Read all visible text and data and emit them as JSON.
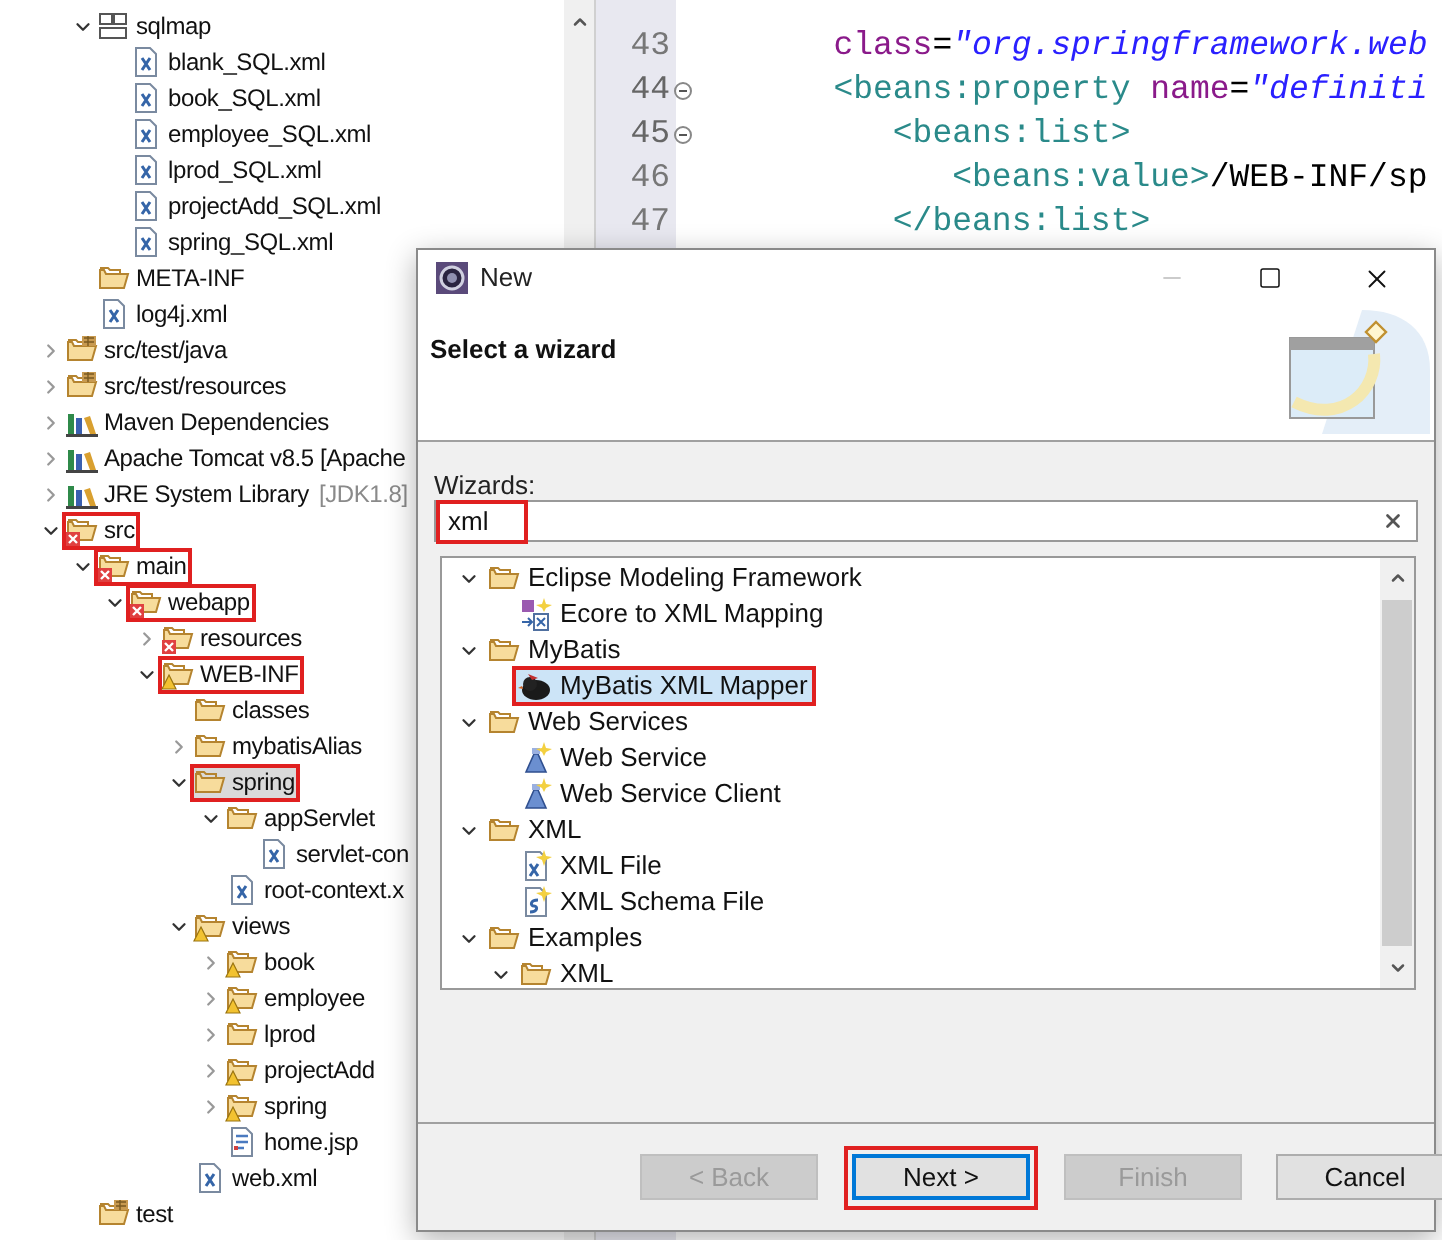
{
  "project_tree": {
    "continued_items": [
      {
        "label": "sqlmap",
        "kind": "package",
        "expanded": true,
        "selected": false,
        "annotated": false,
        "children": [
          {
            "label": "blank_SQL.xml",
            "kind": "xml-file",
            "selected": false,
            "annotated": false
          },
          {
            "label": "book_SQL.xml",
            "kind": "xml-file",
            "selected": false,
            "annotated": false
          },
          {
            "label": "employee_SQL.xml",
            "kind": "xml-file",
            "selected": false,
            "annotated": false
          },
          {
            "label": "lprod_SQL.xml",
            "kind": "xml-file",
            "selected": false,
            "annotated": false
          },
          {
            "label": "projectAdd_SQL.xml",
            "kind": "xml-file",
            "selected": false,
            "annotated": false
          },
          {
            "label": "spring_SQL.xml",
            "kind": "xml-file",
            "selected": false,
            "annotated": false
          }
        ]
      },
      {
        "label": "META-INF",
        "kind": "folder",
        "selected": false,
        "annotated": false
      },
      {
        "label": "log4j.xml",
        "kind": "xml-file",
        "selected": false,
        "annotated": false
      }
    ],
    "items": [
      {
        "label": "src/test/java",
        "kind": "source-folder",
        "expanded": false,
        "selected": false,
        "annotated": false
      },
      {
        "label": "src/test/resources",
        "kind": "source-folder",
        "expanded": false,
        "selected": false,
        "annotated": false
      },
      {
        "label": "Maven Dependencies",
        "kind": "library",
        "expanded": false,
        "selected": false,
        "annotated": false
      },
      {
        "label": "Apache Tomcat v8.5 [Apache",
        "kind": "library",
        "expanded": false,
        "selected": false,
        "annotated": false
      },
      {
        "label": "JRE System Library",
        "suffix": "[JDK1.8]",
        "kind": "library",
        "expanded": false,
        "selected": false,
        "annotated": false
      },
      {
        "label": "src",
        "kind": "error-folder",
        "expanded": true,
        "selected": false,
        "annotated": true,
        "children": [
          {
            "label": "main",
            "kind": "error-folder",
            "expanded": true,
            "selected": false,
            "annotated": true,
            "children": [
              {
                "label": "webapp",
                "kind": "error-folder",
                "expanded": true,
                "selected": false,
                "annotated": true,
                "children": [
                  {
                    "label": "resources",
                    "kind": "error-folder",
                    "expanded": false,
                    "selected": false,
                    "annotated": false
                  },
                  {
                    "label": "WEB-INF",
                    "kind": "warning-folder",
                    "expanded": true,
                    "selected": false,
                    "annotated": true,
                    "children": [
                      {
                        "label": "classes",
                        "kind": "folder",
                        "selected": false,
                        "annotated": false
                      },
                      {
                        "label": "mybatisAlias",
                        "kind": "folder",
                        "expanded": false,
                        "selected": false,
                        "annotated": false
                      },
                      {
                        "label": "spring",
                        "kind": "folder",
                        "expanded": true,
                        "selected": true,
                        "annotated": true,
                        "children": [
                          {
                            "label": "appServlet",
                            "kind": "folder",
                            "expanded": true,
                            "selected": false,
                            "annotated": false,
                            "children": [
                              {
                                "label": "servlet-con",
                                "kind": "xml-file",
                                "selected": false,
                                "annotated": false
                              }
                            ]
                          },
                          {
                            "label": "root-context.x",
                            "kind": "xml-file",
                            "selected": false,
                            "annotated": false
                          }
                        ]
                      },
                      {
                        "label": "views",
                        "kind": "warning-folder",
                        "expanded": true,
                        "selected": false,
                        "annotated": false,
                        "children": [
                          {
                            "label": "book",
                            "kind": "warning-folder",
                            "expanded": false,
                            "selected": false,
                            "annotated": false
                          },
                          {
                            "label": "employee",
                            "kind": "warning-folder",
                            "expanded": false,
                            "selected": false,
                            "annotated": false
                          },
                          {
                            "label": "lprod",
                            "kind": "folder",
                            "expanded": false,
                            "selected": false,
                            "annotated": false
                          },
                          {
                            "label": "projectAdd",
                            "kind": "warning-folder",
                            "expanded": false,
                            "selected": false,
                            "annotated": false
                          },
                          {
                            "label": "spring",
                            "kind": "warning-folder",
                            "expanded": false,
                            "selected": false,
                            "annotated": false
                          },
                          {
                            "label": "home.jsp",
                            "kind": "jsp-file",
                            "selected": false,
                            "annotated": false
                          }
                        ]
                      },
                      {
                        "label": "web.xml",
                        "kind": "xml-file",
                        "selected": false,
                        "annotated": false
                      }
                    ]
                  }
                ]
              }
            ]
          },
          {
            "label": "test",
            "kind": "source-folder",
            "selected": false,
            "annotated": false
          }
        ]
      }
    ]
  },
  "editor": {
    "lines": [
      {
        "number": "43",
        "folded": false,
        "tokens": [
          {
            "text": "   class",
            "kind": "attr"
          },
          {
            "text": "=",
            "kind": "plain"
          },
          {
            "text": "\"org.springframework.web",
            "kind": "string"
          }
        ]
      },
      {
        "number": "44",
        "folded": true,
        "tokens": [
          {
            "text": "   <beans:property",
            "kind": "tag"
          },
          {
            "text": " name",
            "kind": "attr"
          },
          {
            "text": "=",
            "kind": "plain"
          },
          {
            "text": "\"definiti",
            "kind": "string"
          }
        ]
      },
      {
        "number": "45",
        "folded": true,
        "tokens": [
          {
            "text": "      <beans:list>",
            "kind": "tag"
          }
        ]
      },
      {
        "number": "46",
        "folded": false,
        "tokens": [
          {
            "text": "         <beans:value>",
            "kind": "tag"
          },
          {
            "text": "/WEB-INF/sp",
            "kind": "plain"
          }
        ]
      },
      {
        "number": "47",
        "folded": false,
        "tokens": [
          {
            "text": "      </beans:list>",
            "kind": "tag"
          }
        ]
      }
    ]
  },
  "dialog": {
    "title": "New",
    "heading": "Select a wizard",
    "filter_label": "Wizards:",
    "filter": {
      "value": "xml",
      "annotated": true
    },
    "wizards": [
      {
        "label": "Eclipse Modeling Framework",
        "kind": "folder",
        "expanded": true,
        "selected": false,
        "annotated": false,
        "children": [
          {
            "label": "Ecore to XML Mapping",
            "kind": "ecore",
            "selected": false,
            "annotated": false
          }
        ]
      },
      {
        "label": "MyBatis",
        "kind": "folder",
        "expanded": true,
        "selected": false,
        "annotated": false,
        "children": [
          {
            "label": "MyBatis XML Mapper",
            "kind": "mybatis",
            "selected": true,
            "annotated": true
          }
        ]
      },
      {
        "label": "Web Services",
        "kind": "folder",
        "expanded": true,
        "selected": false,
        "annotated": false,
        "children": [
          {
            "label": "Web Service",
            "kind": "web-service",
            "selected": false,
            "annotated": false
          },
          {
            "label": "Web Service Client",
            "kind": "web-service",
            "selected": false,
            "annotated": false
          }
        ]
      },
      {
        "label": "XML",
        "kind": "folder",
        "expanded": true,
        "selected": false,
        "annotated": false,
        "children": [
          {
            "label": "XML File",
            "kind": "xml-new",
            "selected": false,
            "annotated": false
          },
          {
            "label": "XML Schema File",
            "kind": "schema-new",
            "selected": false,
            "annotated": false
          }
        ]
      },
      {
        "label": "Examples",
        "kind": "folder",
        "expanded": true,
        "selected": false,
        "annotated": false,
        "children": [
          {
            "label": "XML",
            "kind": "folder",
            "expanded": true,
            "selected": false,
            "annotated": false
          }
        ]
      }
    ],
    "buttons": [
      {
        "label": "< Back",
        "disabled": true,
        "default": false,
        "annotated": false
      },
      {
        "label": "Next >",
        "disabled": false,
        "default": true,
        "annotated": true
      },
      {
        "label": "Finish",
        "disabled": true,
        "default": false,
        "annotated": false
      },
      {
        "label": "Cancel",
        "disabled": false,
        "default": false,
        "annotated": false
      }
    ]
  }
}
